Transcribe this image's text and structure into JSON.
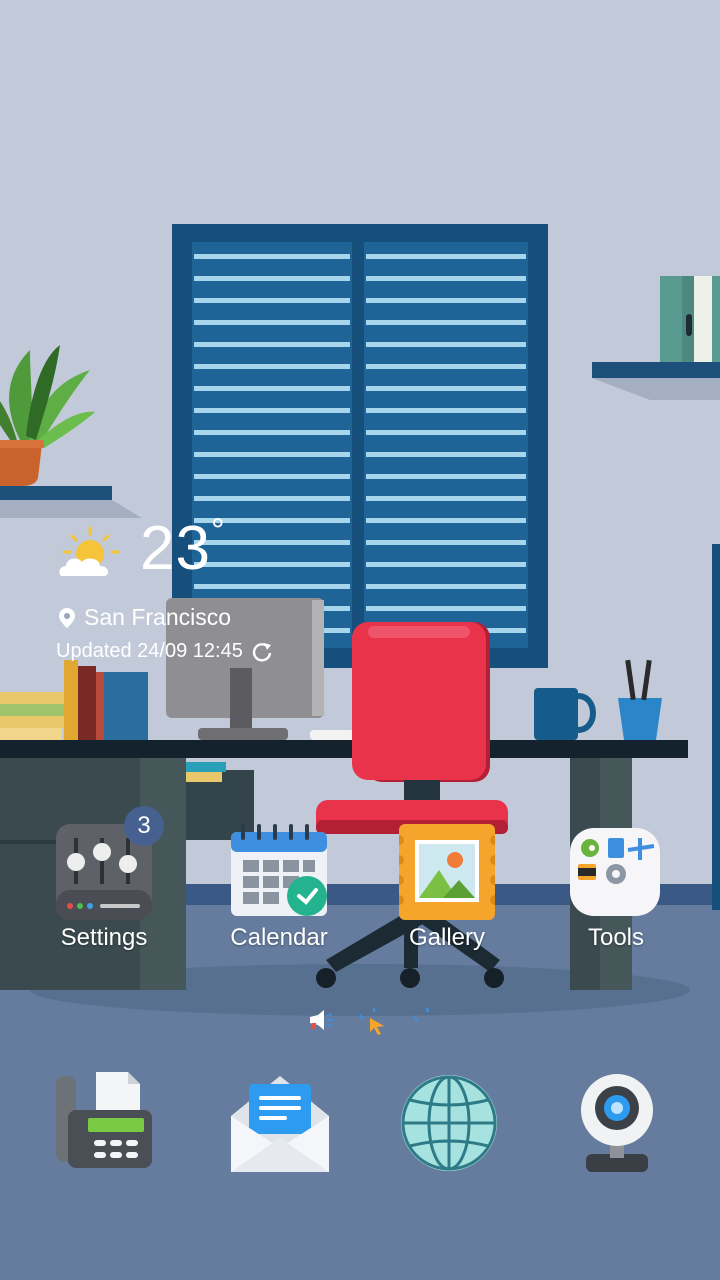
{
  "weather": {
    "temperature": "23",
    "degree_symbol": "°",
    "location": "San Francisco",
    "updated_text": "Updated 24/09 12:45",
    "condition_icon": "partly-sunny-icon"
  },
  "apps": [
    {
      "label": "Settings",
      "icon": "settings-sliders-icon",
      "badge": "3"
    },
    {
      "label": "Calendar",
      "icon": "calendar-icon"
    },
    {
      "label": "Gallery",
      "icon": "gallery-icon"
    },
    {
      "label": "Tools",
      "icon": "tools-folder-icon"
    }
  ],
  "page_indicators": [
    "announcement-page-icon",
    "cursor-page-icon",
    "loading-page-icon"
  ],
  "dock": [
    {
      "name": "fax-phone",
      "icon": "fax-phone-icon"
    },
    {
      "name": "email",
      "icon": "email-icon"
    },
    {
      "name": "browser",
      "icon": "globe-icon"
    },
    {
      "name": "camera",
      "icon": "webcam-icon"
    }
  ],
  "colors": {
    "wall": "#c2c9d8",
    "floor": "#647b9d",
    "chair": "#e8334b",
    "window_frame": "#174f7c",
    "desk": "#14222d",
    "badge": "#46618f"
  }
}
